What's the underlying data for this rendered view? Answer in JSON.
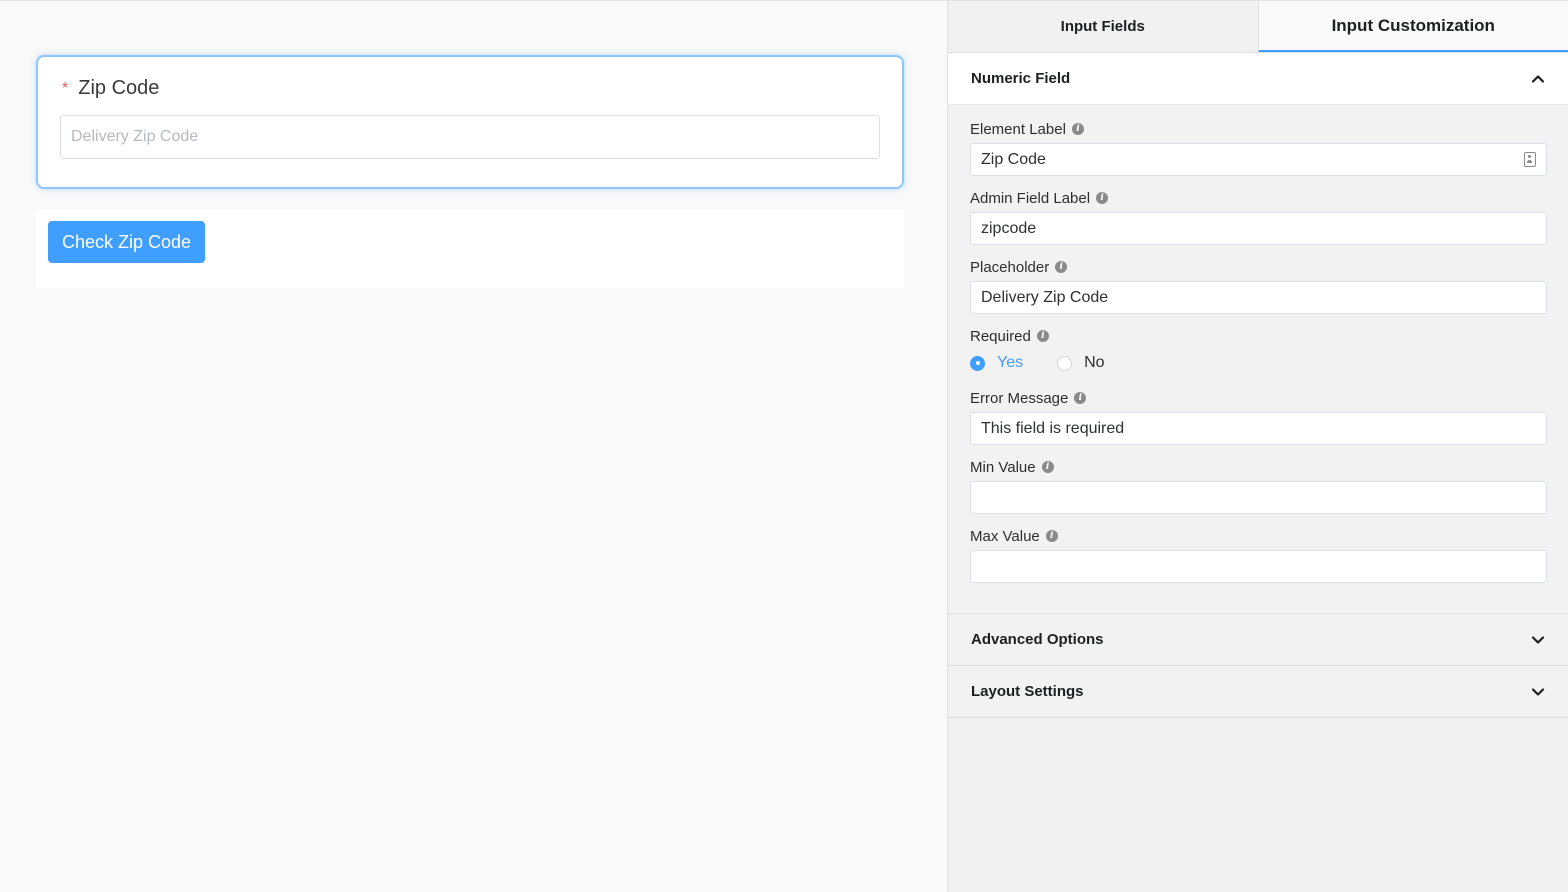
{
  "canvas": {
    "field": {
      "required_mark": "*",
      "label": "Zip Code",
      "placeholder": "Delivery Zip Code"
    },
    "submit_label": "Check Zip Code"
  },
  "panel": {
    "tabs": [
      {
        "label": "Input Fields",
        "active": false
      },
      {
        "label": "Input Customization",
        "active": true
      }
    ],
    "numeric_section": {
      "title": "Numeric Field",
      "element_label": {
        "label": "Element Label",
        "value": "Zip Code"
      },
      "admin_label": {
        "label": "Admin Field Label",
        "value": "zipcode"
      },
      "placeholder": {
        "label": "Placeholder",
        "value": "Delivery Zip Code"
      },
      "required": {
        "label": "Required",
        "options": [
          "Yes",
          "No"
        ],
        "selected": "Yes"
      },
      "error_message": {
        "label": "Error Message",
        "value": "This field is required"
      },
      "min_value": {
        "label": "Min Value",
        "value": ""
      },
      "max_value": {
        "label": "Max Value",
        "value": ""
      }
    },
    "advanced_title": "Advanced Options",
    "layout_title": "Layout Settings"
  },
  "colors": {
    "accent": "#409eff",
    "required_mark": "#e85b5b"
  }
}
